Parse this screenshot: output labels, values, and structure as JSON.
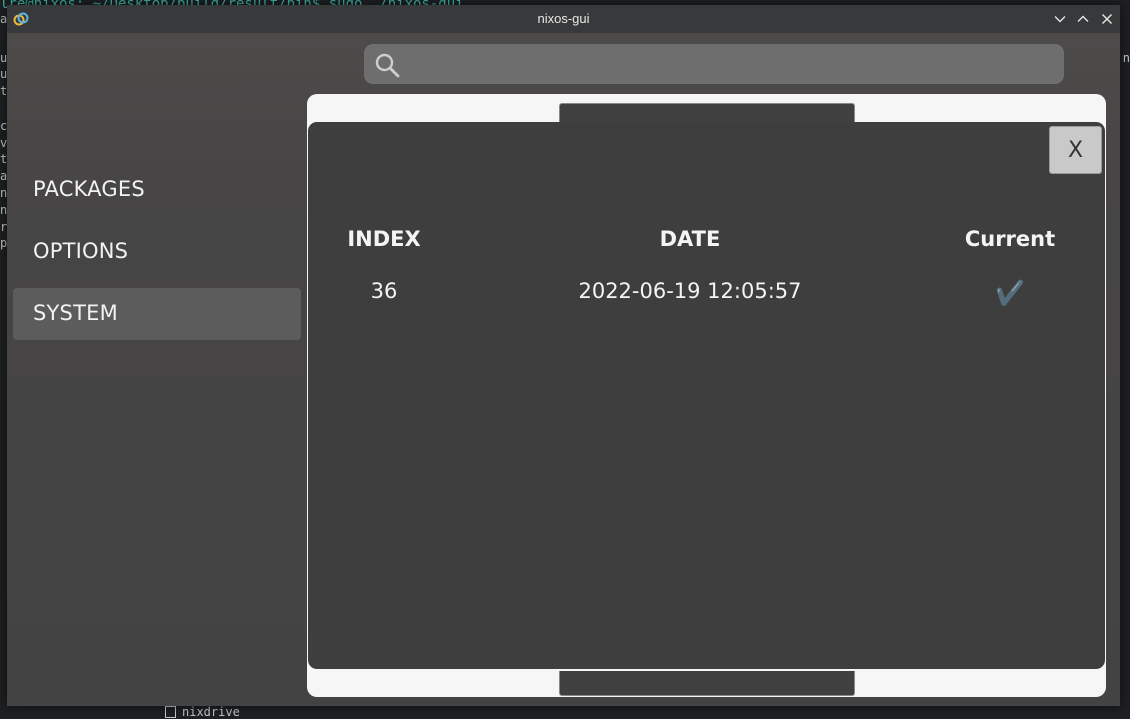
{
  "background": {
    "terminal_prompt": "lre@nixos: ~/Desktop/build/result/bin$ sudo ./nixos-gui",
    "terminal_lines": [
      "a",
      "",
      "u",
      "u",
      "t",
      "",
      "c",
      "v",
      "t",
      "a",
      "n",
      "n",
      "r",
      "p"
    ],
    "right_edge_char": "n",
    "bottom_file": "nixdrive"
  },
  "window": {
    "title": "nixos-gui",
    "controls": {
      "minimize": "minimize",
      "maximize": "maximize",
      "close": "close"
    }
  },
  "search": {
    "placeholder": "",
    "value": ""
  },
  "sidebar": {
    "items": [
      {
        "label": "PACKAGES",
        "active": false
      },
      {
        "label": "OPTIONS",
        "active": false
      },
      {
        "label": "SYSTEM",
        "active": true
      }
    ]
  },
  "dialog": {
    "close_label": "X",
    "table": {
      "headers": {
        "index": "INDEX",
        "date": "DATE",
        "current": "Current"
      },
      "rows": [
        {
          "index": "36",
          "date": "2022-06-19 12:05:57",
          "current": "✔️"
        }
      ]
    }
  },
  "colors": {
    "window_bg": "#464444",
    "titlebar_bg": "#38393b",
    "sheet_bg": "#f6f6f6",
    "dialog_bg": "#3e3e3e",
    "active_nav_bg": "#5c5c5c",
    "search_bg": "#6e6e6e"
  }
}
